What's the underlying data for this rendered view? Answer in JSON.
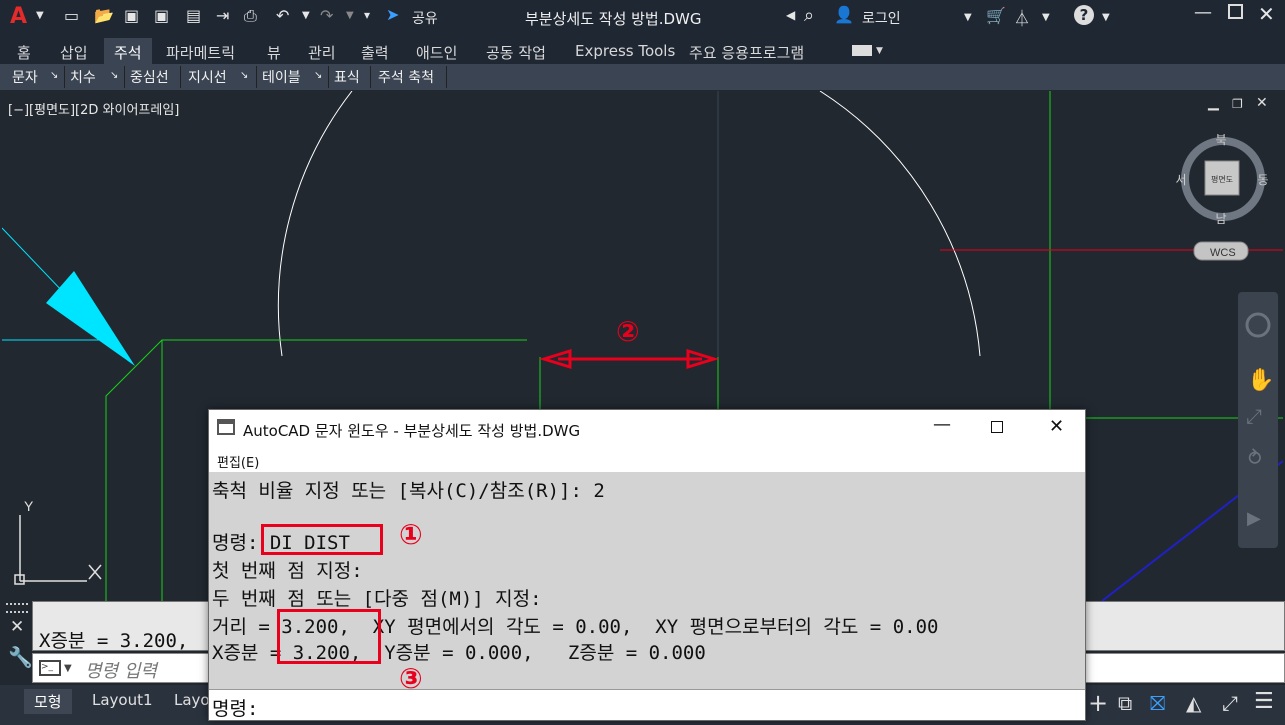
{
  "app": {
    "logo": "A",
    "title": "부분상세도 작성 방법.DWG",
    "share_label": "공유",
    "login_label": "로그인"
  },
  "ribbon": {
    "tabs": [
      "홈",
      "삽입",
      "주석",
      "파라메트릭",
      "뷰",
      "관리",
      "출력",
      "애드인",
      "공동 작업",
      "Express Tools",
      "주요 응용프로그램"
    ],
    "active_tab": "주석",
    "panels": [
      "문자",
      "치수",
      "중심선",
      "지시선",
      "테이블",
      "표식",
      "주석 축척"
    ]
  },
  "viewport": {
    "label": "[−][평면도][2D 와이어프레임]",
    "viewcube": {
      "north": "북",
      "south": "남",
      "east": "동",
      "west": "서",
      "face": "평면도"
    },
    "wcs_label": "WCS",
    "ucs_y": "Y"
  },
  "annotations": {
    "one": "①",
    "two": "②",
    "three": "③"
  },
  "command_line": {
    "history": "X증분 = 3.200,",
    "placeholder": "명령 입력"
  },
  "layout_tabs": [
    "모형",
    "Layout1",
    "Layo"
  ],
  "text_window": {
    "title": "AutoCAD 문자 윈도우 - 부분상세도 작성 방법.DWG",
    "menu_edit": "편집(E)",
    "lines": [
      "축척 비율 지정 또는 [복사(C)/참조(R)]: 2",
      "명령: DI DIST",
      "첫 번째 점 지정:",
      "두 번째 점 또는 [다중 점(M)] 지정:",
      "거리 = 3.200,  XY 평면에서의 각도 = 0.00,  XY 평면으로부터의 각도 = 0.00",
      "X증분 = 3.200,  Y증분 = 0.000,   Z증분 = 0.000"
    ],
    "prompt": "명령:"
  },
  "colors": {
    "accent_red": "#e8001c",
    "line_green": "#19d11a",
    "cyan": "#00e5ff",
    "bg_dark": "#212830"
  }
}
